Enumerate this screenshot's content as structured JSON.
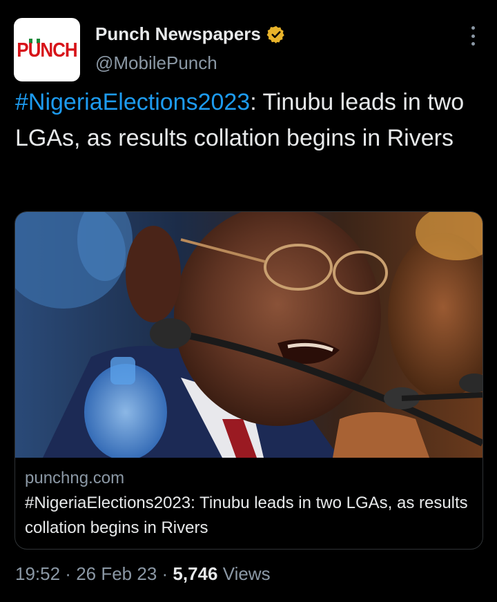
{
  "author": {
    "avatar_text": "PUNCH",
    "display_name": "Punch Newspapers",
    "handle": "@MobilePunch",
    "verified_badge_color": "#e8b32a"
  },
  "tweet": {
    "hashtag": "#NigeriaElections2023",
    "text": ": Tinubu leads in two LGAs, as results collation begins in Rivers"
  },
  "link_card": {
    "domain": "punchng.com",
    "title": "#NigeriaElections2023: Tinubu leads in two LGAs, as results collation begins in Rivers"
  },
  "meta": {
    "time": "19:52",
    "separator": " · ",
    "date": "26 Feb 23",
    "views_count": "5,746",
    "views_label": " Views"
  },
  "icons": {
    "verified": "verified-badge-icon",
    "more": "more-options-icon"
  },
  "colors": {
    "background": "#000000",
    "link_blue": "#1d9bf0",
    "secondary_text": "#8b98a5",
    "primary_text": "#e7e9ea",
    "brand_red": "#d7141a"
  }
}
